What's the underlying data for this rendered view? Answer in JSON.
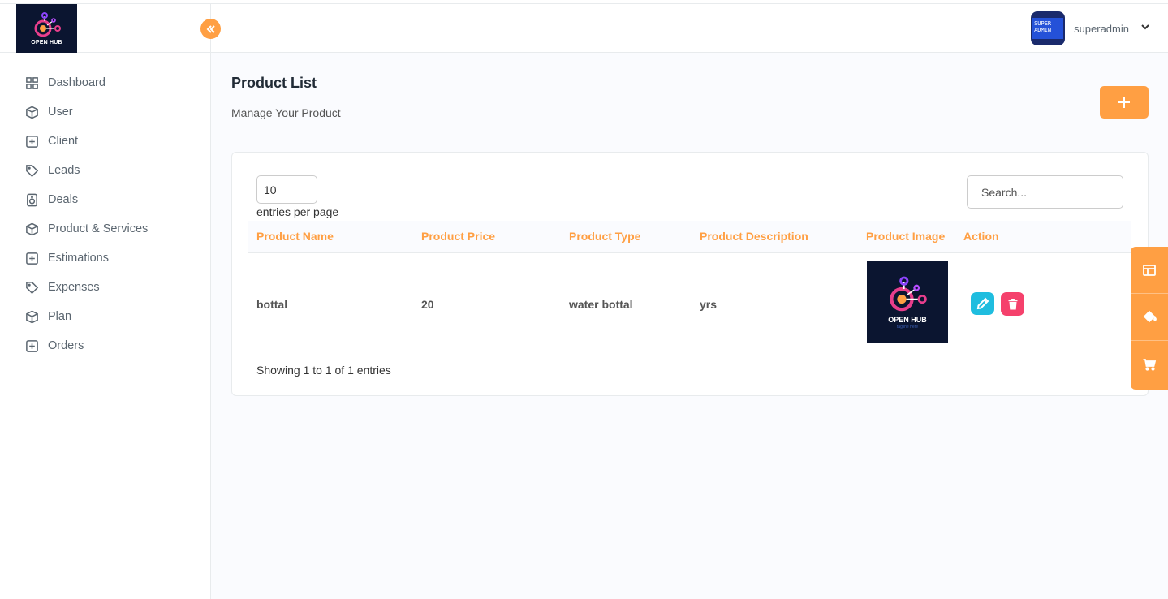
{
  "brand": {
    "logo_text": "OPEN HUB"
  },
  "sidebar": {
    "items": [
      {
        "label": "Dashboard",
        "icon": "grid-icon"
      },
      {
        "label": "User",
        "icon": "box-icon"
      },
      {
        "label": "Client",
        "icon": "plus-square-icon"
      },
      {
        "label": "Leads",
        "icon": "tag-icon"
      },
      {
        "label": "Deals",
        "icon": "speaker-icon"
      },
      {
        "label": "Product & Services",
        "icon": "box-icon"
      },
      {
        "label": "Estimations",
        "icon": "plus-square-icon"
      },
      {
        "label": "Expenses",
        "icon": "tag-icon"
      },
      {
        "label": "Plan",
        "icon": "box-icon"
      },
      {
        "label": "Orders",
        "icon": "plus-square-icon"
      }
    ]
  },
  "header": {
    "user_name": "superadmin",
    "avatar_text": "SUPER ADMIN"
  },
  "page": {
    "title": "Product List",
    "subtitle": "Manage Your Product"
  },
  "table_controls": {
    "entries_value": "10",
    "entries_label": "entries per page",
    "search_placeholder": "Search..."
  },
  "table": {
    "columns": [
      "Product Name",
      "Product Price",
      "Product Type",
      "Product Description",
      "Product Image",
      "Action"
    ],
    "rows": [
      {
        "name": "bottal",
        "price": "20",
        "type": "water bottal",
        "description": "yrs",
        "image_text": "OPEN HUB",
        "image_tagline": "tagline here"
      }
    ],
    "footer": "Showing 1 to 1 of 1 entries"
  },
  "colors": {
    "accent": "#ff9f43",
    "edit": "#1fbddf",
    "delete": "#f5416c"
  }
}
